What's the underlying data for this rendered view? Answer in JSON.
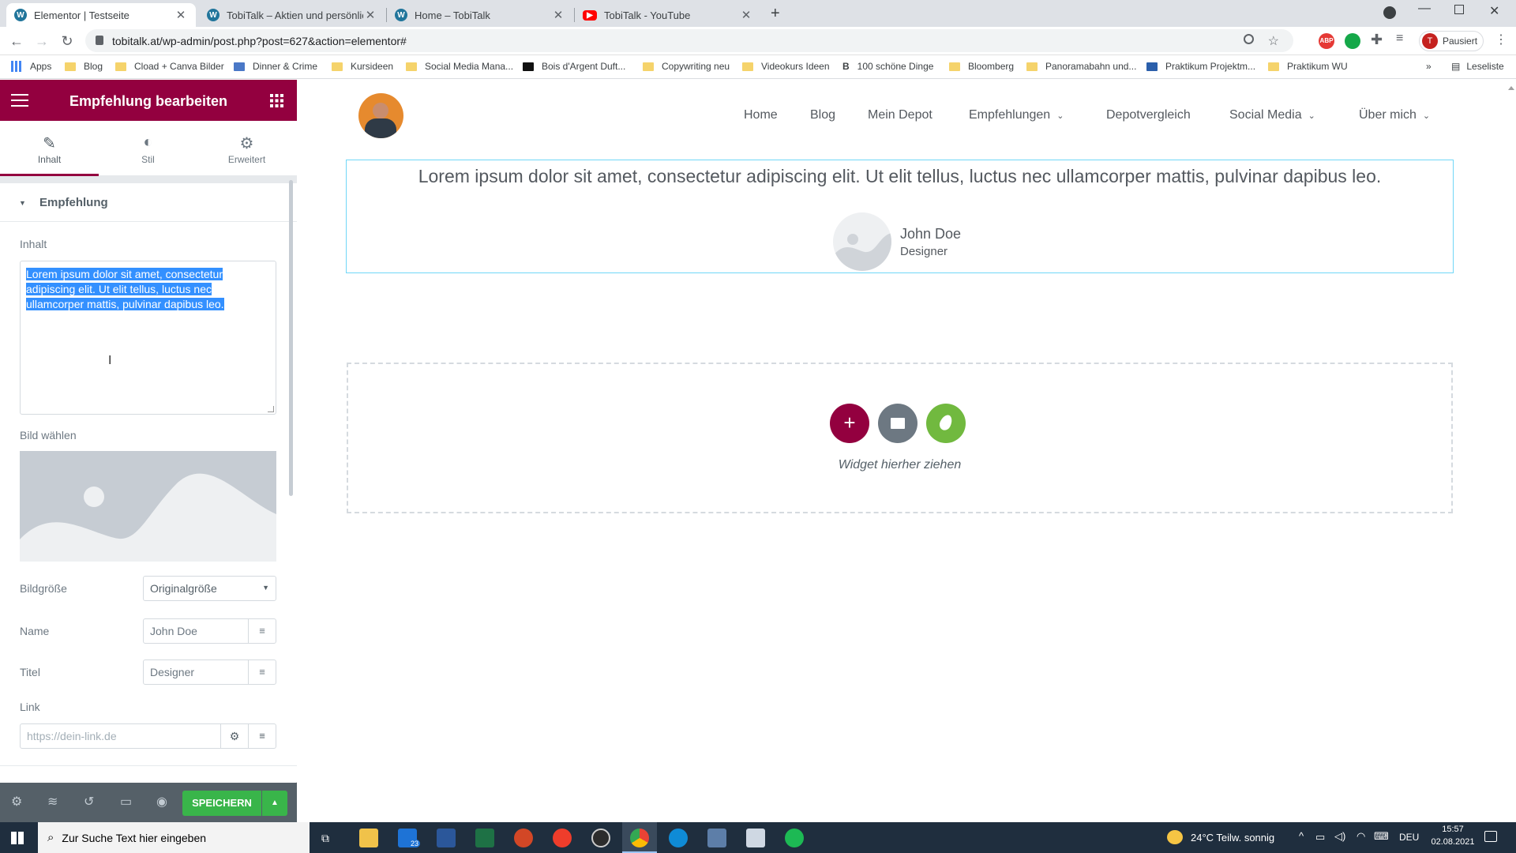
{
  "browser": {
    "tabs": [
      {
        "label": "Elementor | Testseite",
        "icon": "wordpress-icon"
      },
      {
        "label": "TobiTalk – Aktien und persönliche",
        "icon": "wordpress-icon"
      },
      {
        "label": "Home – TobiTalk",
        "icon": "wordpress-icon"
      },
      {
        "label": "TobiTalk - YouTube",
        "icon": "youtube-icon"
      }
    ],
    "url": "tobitalk.at/wp-admin/post.php?post=627&action=elementor#",
    "profile_label": "Pausiert",
    "profile_initial": "T",
    "bookmarks": [
      "Apps",
      "Blog",
      "Cload + Canva Bilder",
      "Dinner & Crime",
      "Kursideen",
      "Social Media Mana...",
      "Bois d'Argent Duft...",
      "Copywriting neu",
      "Videokurs Ideen",
      "100 schöne Dinge",
      "Bloomberg",
      "Panoramabahn und...",
      "Praktikum Projektm...",
      "Praktikum WU"
    ],
    "reading_list": "Leseliste"
  },
  "panel": {
    "title": "Empfehlung bearbeiten",
    "tabs": [
      "Inhalt",
      "Stil",
      "Erweitert"
    ],
    "section_title": "Empfehlung",
    "content_label": "Inhalt",
    "content_text": "Lorem ipsum dolor sit amet, consectetur adipiscing elit. Ut elit tellus, luctus nec ullamcorper mattis, pulvinar dapibus leo.",
    "image_label": "Bild wählen",
    "image_size_label": "Bildgröße",
    "image_size_value": "Originalgröße",
    "name_label": "Name",
    "name_value": "John Doe",
    "title_label": "Titel",
    "title_value": "Designer",
    "link_label": "Link",
    "link_placeholder": "https://dein-link.de",
    "save_label": "SPEICHERN"
  },
  "site": {
    "nav": [
      "Home",
      "Blog",
      "Mein Depot",
      "Empfehlungen",
      "Depotvergleich",
      "Social Media",
      "Über mich"
    ],
    "testimonial_text": "Lorem ipsum dolor sit amet, consectetur adipiscing elit. Ut elit tellus, luctus nec ullamcorper mattis, pulvinar dapibus leo.",
    "testimonial_name": "John Doe",
    "testimonial_title": "Designer",
    "drop_hint": "Widget hierher ziehen"
  },
  "taskbar": {
    "search_placeholder": "Zur Suche Text hier eingeben",
    "weather": "24°C  Teilw. sonnig",
    "language": "DEU",
    "time": "15:57",
    "date": "02.08.2021",
    "mail_badge": "23"
  },
  "colors": {
    "elementor_primary": "#93003f",
    "save_green": "#39b54a",
    "folder_grey": "#6d7882",
    "template_green": "#71d7a0"
  }
}
